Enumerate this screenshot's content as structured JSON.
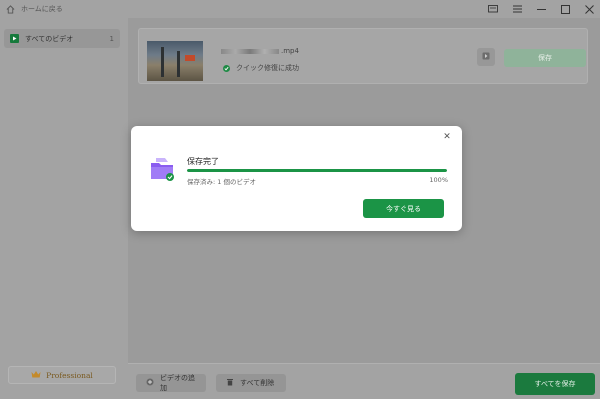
{
  "titlebar": {
    "home_label": "ホームに戻る",
    "icons": [
      "home-icon",
      "feedback-icon",
      "menu-icon",
      "minimize-icon",
      "maximize-icon",
      "close-icon"
    ]
  },
  "sidebar": {
    "items": [
      {
        "label": "すべてのビデオ",
        "count": "1",
        "icon": "play-icon"
      }
    ],
    "pro_label": "Professional",
    "pro_icon": "crown-icon"
  },
  "video": {
    "filename_suffix": ".mp4",
    "status": "クイック修復に成功",
    "save_label": "保存"
  },
  "bottombar": {
    "add_label": "ビデオの追加",
    "delete_label": "すべて削除",
    "save_all_label": "すべてを保存"
  },
  "dialog": {
    "title": "保存完了",
    "subtitle": "保存済み: 1 個のビデオ",
    "progress_percent": "100%",
    "progress_value": 1.0,
    "button_label": "今すぐ見る"
  },
  "colors": {
    "accent": "#1b9446",
    "overlay": "#9b9b9b",
    "dialog_bg": "#ffffff",
    "folder_purple": "#8a5cf0"
  }
}
